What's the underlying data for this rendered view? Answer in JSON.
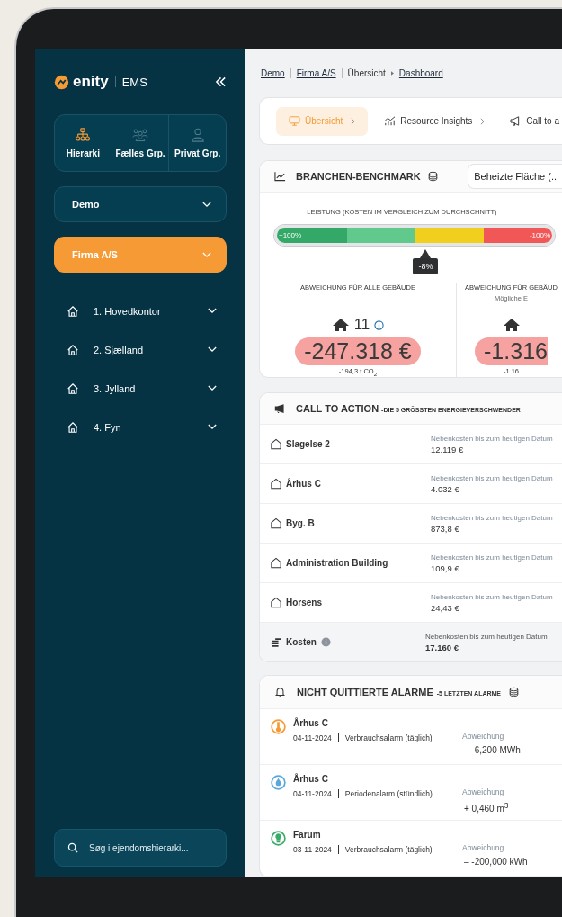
{
  "sidebar": {
    "brand": "enity",
    "product": "EMS",
    "views": [
      {
        "label": "Hierarki",
        "selected": true
      },
      {
        "label": "Fælles Grp.",
        "selected": false
      },
      {
        "label": "Privat Grp.",
        "selected": false
      }
    ],
    "selectors": [
      {
        "label": "Demo",
        "selected": false
      },
      {
        "label": "Firma A/S",
        "selected": true
      }
    ],
    "tree": [
      {
        "label": "1. Hovedkontor",
        "expanded": false
      },
      {
        "label": "2. Sjælland",
        "expanded": false
      },
      {
        "label": "3. Jylland",
        "expanded": false
      },
      {
        "label": "4. Fyn",
        "expanded": false
      }
    ],
    "search": {
      "placeholder": "Søg i ejendomshierarki..."
    }
  },
  "breadcrumb": [
    {
      "label": "Demo",
      "link": true
    },
    {
      "label": "Firma A/S",
      "link": true
    },
    {
      "label": "Übersicht",
      "link": false
    },
    {
      "label": "Dashboard",
      "link": true
    }
  ],
  "tabs": [
    {
      "label": "Übersicht",
      "chevron": true,
      "selected": true
    },
    {
      "label": "Resource Insights",
      "chevron": true,
      "selected": false
    },
    {
      "label": "Call to a",
      "chevron": false,
      "selected": false
    }
  ],
  "benchmark": {
    "title": "BRANCHEN-BENCHMARK",
    "dropdown": "Beheizte Fläche (..",
    "gauge": {
      "title": "LEISTUNG (KOSTEN IM VERGLEICH ZUM DURCHSCHNITT)",
      "left_label": "+100%",
      "right_label": "-100%",
      "marker": {
        "label": "-8%",
        "level": 0.54
      }
    },
    "stats": [
      {
        "heading": "ABWEICHUNG FÜR ALLE GEBÄUDE",
        "count": "11",
        "amount": "-247.318 €",
        "co2": "-194,3 t CO$_{2}$"
      },
      {
        "heading": "ABWEICHUNG FÜR GEBÄUD",
        "subheading": "Mögliche E",
        "amount": "-1.316",
        "co2": "-1.16"
      }
    ]
  },
  "call_to_action": {
    "title": "CALL TO ACTION",
    "subtitle": "-DIE 5 GRÖSSTEN ENERGIEVERSCHWENDER",
    "rows": [
      {
        "name": "Slagelse 2",
        "label": "Nebenkosten bis zum heutigen Datum",
        "value": "12.119 €"
      },
      {
        "name": "Århus C",
        "label": "Nebenkosten bis zum heutigen Datum",
        "value": "4.032 €"
      },
      {
        "name": "Byg. B",
        "label": "Nebenkosten bis zum heutigen Datum",
        "value": "873,8 €"
      },
      {
        "name": "Administration Building",
        "label": "Nebenkosten bis zum heutigen Datum",
        "value": "109,9 €"
      },
      {
        "name": "Horsens",
        "label": "Nebenkosten bis zum heutigen Datum",
        "value": "24,43 €"
      }
    ],
    "total": {
      "name": "Kosten",
      "label": "Nebenkosten bis zum heutigen Datum",
      "value": "17.160 €"
    }
  },
  "alarms": {
    "title": "NICHT QUITTIERTE ALARME",
    "subtitle": "-5 LETZTEN ALARME",
    "items": [
      {
        "kind": "heat",
        "color": "#f59a35",
        "name": "Århus C",
        "date": "04-11-2024",
        "type": "Verbrauchsalarm (täglich)",
        "label": "Abweichung",
        "value": "– -6,200 MWh"
      },
      {
        "kind": "water",
        "color": "#5aa7dc",
        "name": "Århus C",
        "date": "04-11-2024",
        "type": "Periodenalarm (stündlich)",
        "label": "Abweichung",
        "value": "+ 0,460 m$^{3}$"
      },
      {
        "kind": "electricity",
        "color": "#3bab6a",
        "name": "Farum",
        "date": "03-11-2024",
        "type": "Verbrauchsalarm (täglich)",
        "label": "Abweichung",
        "value": "– -200,000 kWh"
      }
    ]
  }
}
